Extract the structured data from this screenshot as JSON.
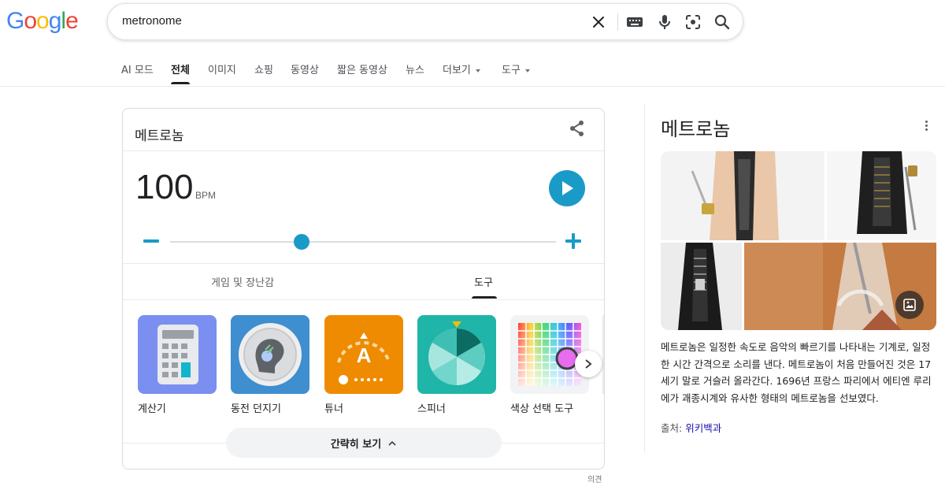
{
  "logo": {
    "letters": [
      "G",
      "o",
      "o",
      "g",
      "l",
      "e"
    ],
    "colors": [
      "#4285F4",
      "#EA4335",
      "#FBBC05",
      "#4285F4",
      "#34A853",
      "#EA4335"
    ]
  },
  "search": {
    "query": "metronome",
    "icons": [
      "clear-icon",
      "keyboard-icon",
      "mic-icon",
      "lens-icon",
      "search-icon"
    ]
  },
  "tabs": [
    {
      "label": "AI 모드"
    },
    {
      "label": "전체",
      "active": true
    },
    {
      "label": "이미지"
    },
    {
      "label": "쇼핑"
    },
    {
      "label": "동영상"
    },
    {
      "label": "짧은 동영상"
    },
    {
      "label": "뉴스"
    },
    {
      "label": "더보기",
      "dropdown": true
    },
    {
      "label": "도구",
      "dropdown": true
    }
  ],
  "card": {
    "title": "메트로놈",
    "bpm": "100",
    "bpm_unit": "BPM",
    "tempo_fraction": 0.34,
    "subtabs": [
      "게임 및 장난감",
      "도구"
    ],
    "active_subtab": "도구",
    "tiles": [
      {
        "label": "계산기",
        "icon": "calculator-icon"
      },
      {
        "label": "동전 던지기",
        "icon": "coin-flip-icon"
      },
      {
        "label": "튜너",
        "icon": "tuner-icon",
        "letter": "A"
      },
      {
        "label": "스피너",
        "icon": "spinner-icon"
      },
      {
        "label": "색상 선택 도구",
        "icon": "color-picker-icon"
      }
    ],
    "collapse_label": "간략히 보기",
    "accent": "#1a9bc7"
  },
  "feedback": "의견",
  "knowledge_panel": {
    "title": "메트로놈",
    "description": "메트로놈은 일정한 속도로 음악의 빠르기를 나타내는 기계로, 일정한 시간 간격으로 소리를 낸다. 메트로놈이 처음 만들어진 것은 17세기 말로 거슬러 올라간다. 1696년 프랑스 파리에서 에티엔 루리에가 괘종시계와 유사한 형태의 메트로놈을 선보였다.",
    "source_prefix": "출처:",
    "source_link": "위키백과"
  }
}
